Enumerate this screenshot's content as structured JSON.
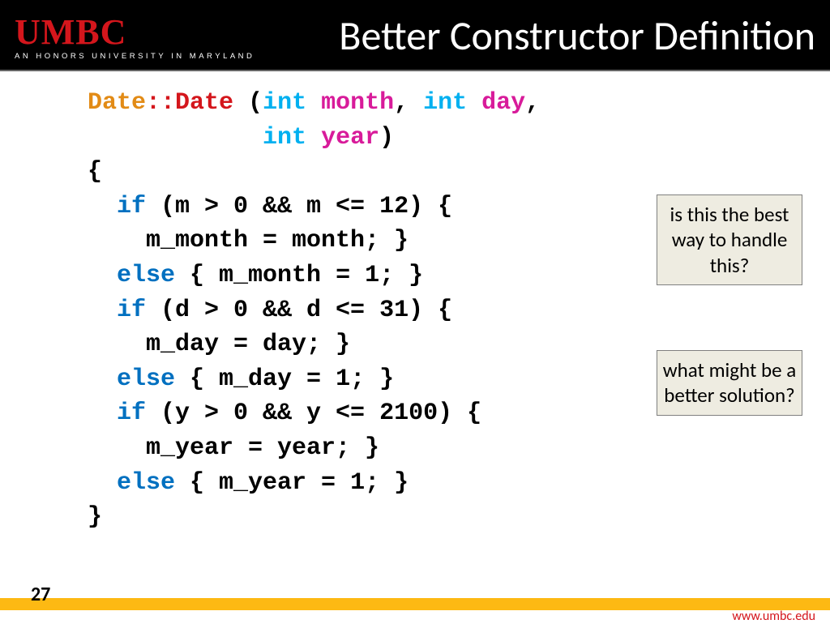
{
  "header": {
    "logo": "UMBC",
    "tagline": "AN HONORS UNIVERSITY IN MARYLAND",
    "title": "Better Constructor Definition"
  },
  "code": {
    "l1": {
      "cls": "Date",
      "scope": "::",
      "ctor": "Date",
      "open": " (",
      "t1": "int",
      "sp1": " ",
      "p1": "month",
      "c1": ", ",
      "t2": "int",
      "sp2": " ",
      "p2": "day",
      "c2": ","
    },
    "l2": {
      "pad": "            ",
      "t": "int",
      "sp": " ",
      "p": "year",
      "close": ")"
    },
    "l3": "{",
    "l4": {
      "kw": "  if",
      "rest": " (m > 0 && m <= 12) {"
    },
    "l5": "    m_month = month; }",
    "l6": {
      "kw": "  else",
      "rest": " { m_month = 1; }"
    },
    "l7": {
      "kw": "  if",
      "rest": " (d > 0 && d <= 31) {"
    },
    "l8": "    m_day = day; }",
    "l9": {
      "kw": "  else",
      "rest": " { m_day = 1; }"
    },
    "l10": {
      "kw": "  if",
      "rest": " (y > 0 && y <= 2100) {"
    },
    "l11": "    m_year = year; }",
    "l12": {
      "kw": "  else",
      "rest": " { m_year = 1; }"
    },
    "l13": "}"
  },
  "callouts": {
    "one": "is this the best way to handle this?",
    "two": "what might be a better solution?"
  },
  "footer": {
    "page": "27",
    "url": "www.umbc.edu"
  }
}
